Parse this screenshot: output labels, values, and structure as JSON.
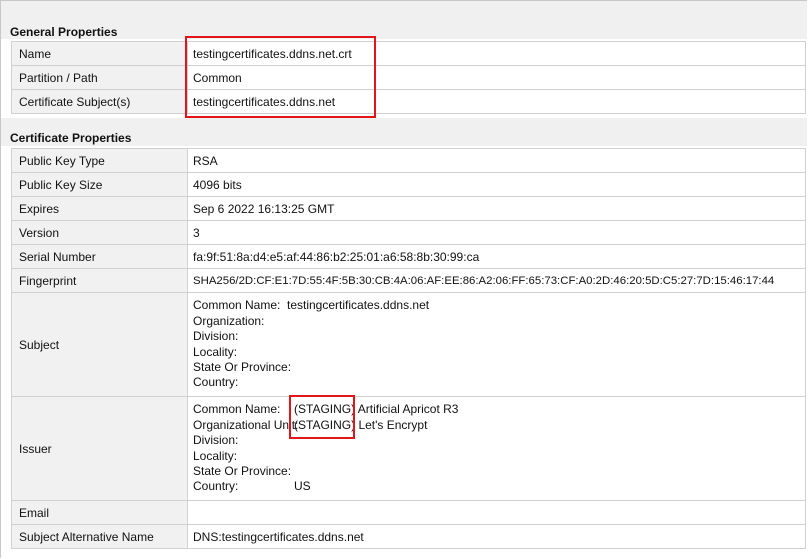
{
  "general": {
    "title": "General Properties",
    "rows": [
      {
        "label": "Name",
        "value": "testingcertificates.ddns.net.crt"
      },
      {
        "label": "Partition / Path",
        "value": "Common"
      },
      {
        "label": "Certificate Subject(s)",
        "value": "testingcertificates.ddns.net"
      }
    ]
  },
  "certificate": {
    "title": "Certificate Properties",
    "rows": [
      {
        "label": "Public Key Type",
        "value": "RSA"
      },
      {
        "label": "Public Key Size",
        "value": "4096 bits"
      },
      {
        "label": "Expires",
        "value": "Sep 6 2022 16:13:25 GMT"
      },
      {
        "label": "Version",
        "value": "3"
      },
      {
        "label": "Serial Number",
        "value": "fa:9f:51:8a:d4:e5:af:44:86:b2:25:01:a6:58:8b:30:99:ca"
      },
      {
        "label": "Fingerprint",
        "value": "SHA256/2D:CF:E1:7D:55:4F:5B:30:CB:4A:06:AF:EE:86:A2:06:FF:65:73:CF:A0:2D:46:20:5D:C5:27:7D:15:46:17:44"
      }
    ],
    "subject": {
      "label": "Subject",
      "fields": [
        {
          "key": "Common Name:",
          "value": "testingcertificates.ddns.net"
        },
        {
          "key": "Organization:",
          "value": ""
        },
        {
          "key": "Division:",
          "value": ""
        },
        {
          "key": "Locality:",
          "value": ""
        },
        {
          "key": "State Or Province:",
          "value": ""
        },
        {
          "key": "Country:",
          "value": ""
        }
      ]
    },
    "issuer": {
      "label": "Issuer",
      "fields": [
        {
          "key": "Common Name:",
          "value": "(STAGING) Artificial Apricot R3"
        },
        {
          "key": "Organizational Unit:",
          "value": "(STAGING) Let's Encrypt"
        },
        {
          "key": "Division:",
          "value": ""
        },
        {
          "key": "Locality:",
          "value": ""
        },
        {
          "key": "State Or Province:",
          "value": ""
        },
        {
          "key": "Country:",
          "value": "US"
        }
      ]
    },
    "email": {
      "label": "Email",
      "value": ""
    },
    "san": {
      "label": "Subject Alternative Name",
      "value": "DNS:testingcertificates.ddns.net"
    }
  },
  "colors": {
    "highlight": "#e0161a",
    "label_bg": "#f1f1f1",
    "border": "#d0d0d0"
  }
}
